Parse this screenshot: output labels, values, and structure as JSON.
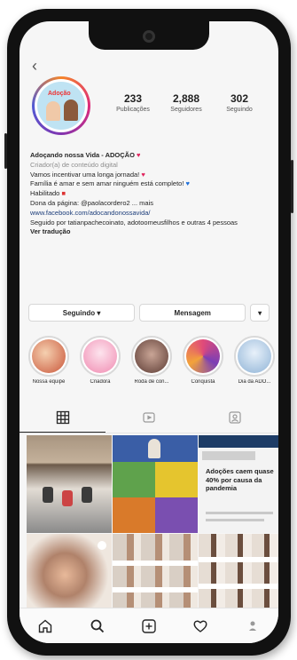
{
  "profile": {
    "stats": [
      {
        "value": "233",
        "label": "Publicações"
      },
      {
        "value": "2,888",
        "label": "Seguidores"
      },
      {
        "value": "302",
        "label": "Seguindo"
      }
    ],
    "avatar_text": "Adoção"
  },
  "bio": {
    "name": "Adoçando nossa Vida - ADOÇÃO",
    "category": "Criador(a) de conteúdo digital",
    "line1": "Vamos incentivar uma longa jornada!",
    "line2": "Família é amar e sem amar ninguém está completo!",
    "line3": "Habilitado",
    "owner": "Dona da página: @paolacordero2 ... mais",
    "url": "www.facebook.com/adocandonossavida/",
    "followed_by": "Seguido por tatianpachecoinato, adotoomeusfilhos e outras 4 pessoas",
    "translate": "Ver tradução"
  },
  "buttons": {
    "follow": "Seguindo ▾",
    "message": "Mensagem",
    "more": "▾"
  },
  "highlights": [
    {
      "label": "Nossa equipe",
      "color": "#e98c6b"
    },
    {
      "label": "Criadora",
      "color": "#f6a5bf"
    },
    {
      "label": "Roda de con...",
      "color": "#8a5a4f"
    },
    {
      "label": "Conquista",
      "color": "#d64a74"
    },
    {
      "label": "Dia da ADO...",
      "color": "#9fbfdd"
    }
  ],
  "grid": {
    "news_headline": "Adoções caem quase 40% por causa da pandemia"
  },
  "icons": {
    "grid_tab": "grid-icon",
    "tagged_tab": "person-tag-icon",
    "home": "home-icon",
    "search": "search-icon",
    "add": "plus-square-icon",
    "activity": "heart-icon",
    "profile": "profile-icon"
  }
}
